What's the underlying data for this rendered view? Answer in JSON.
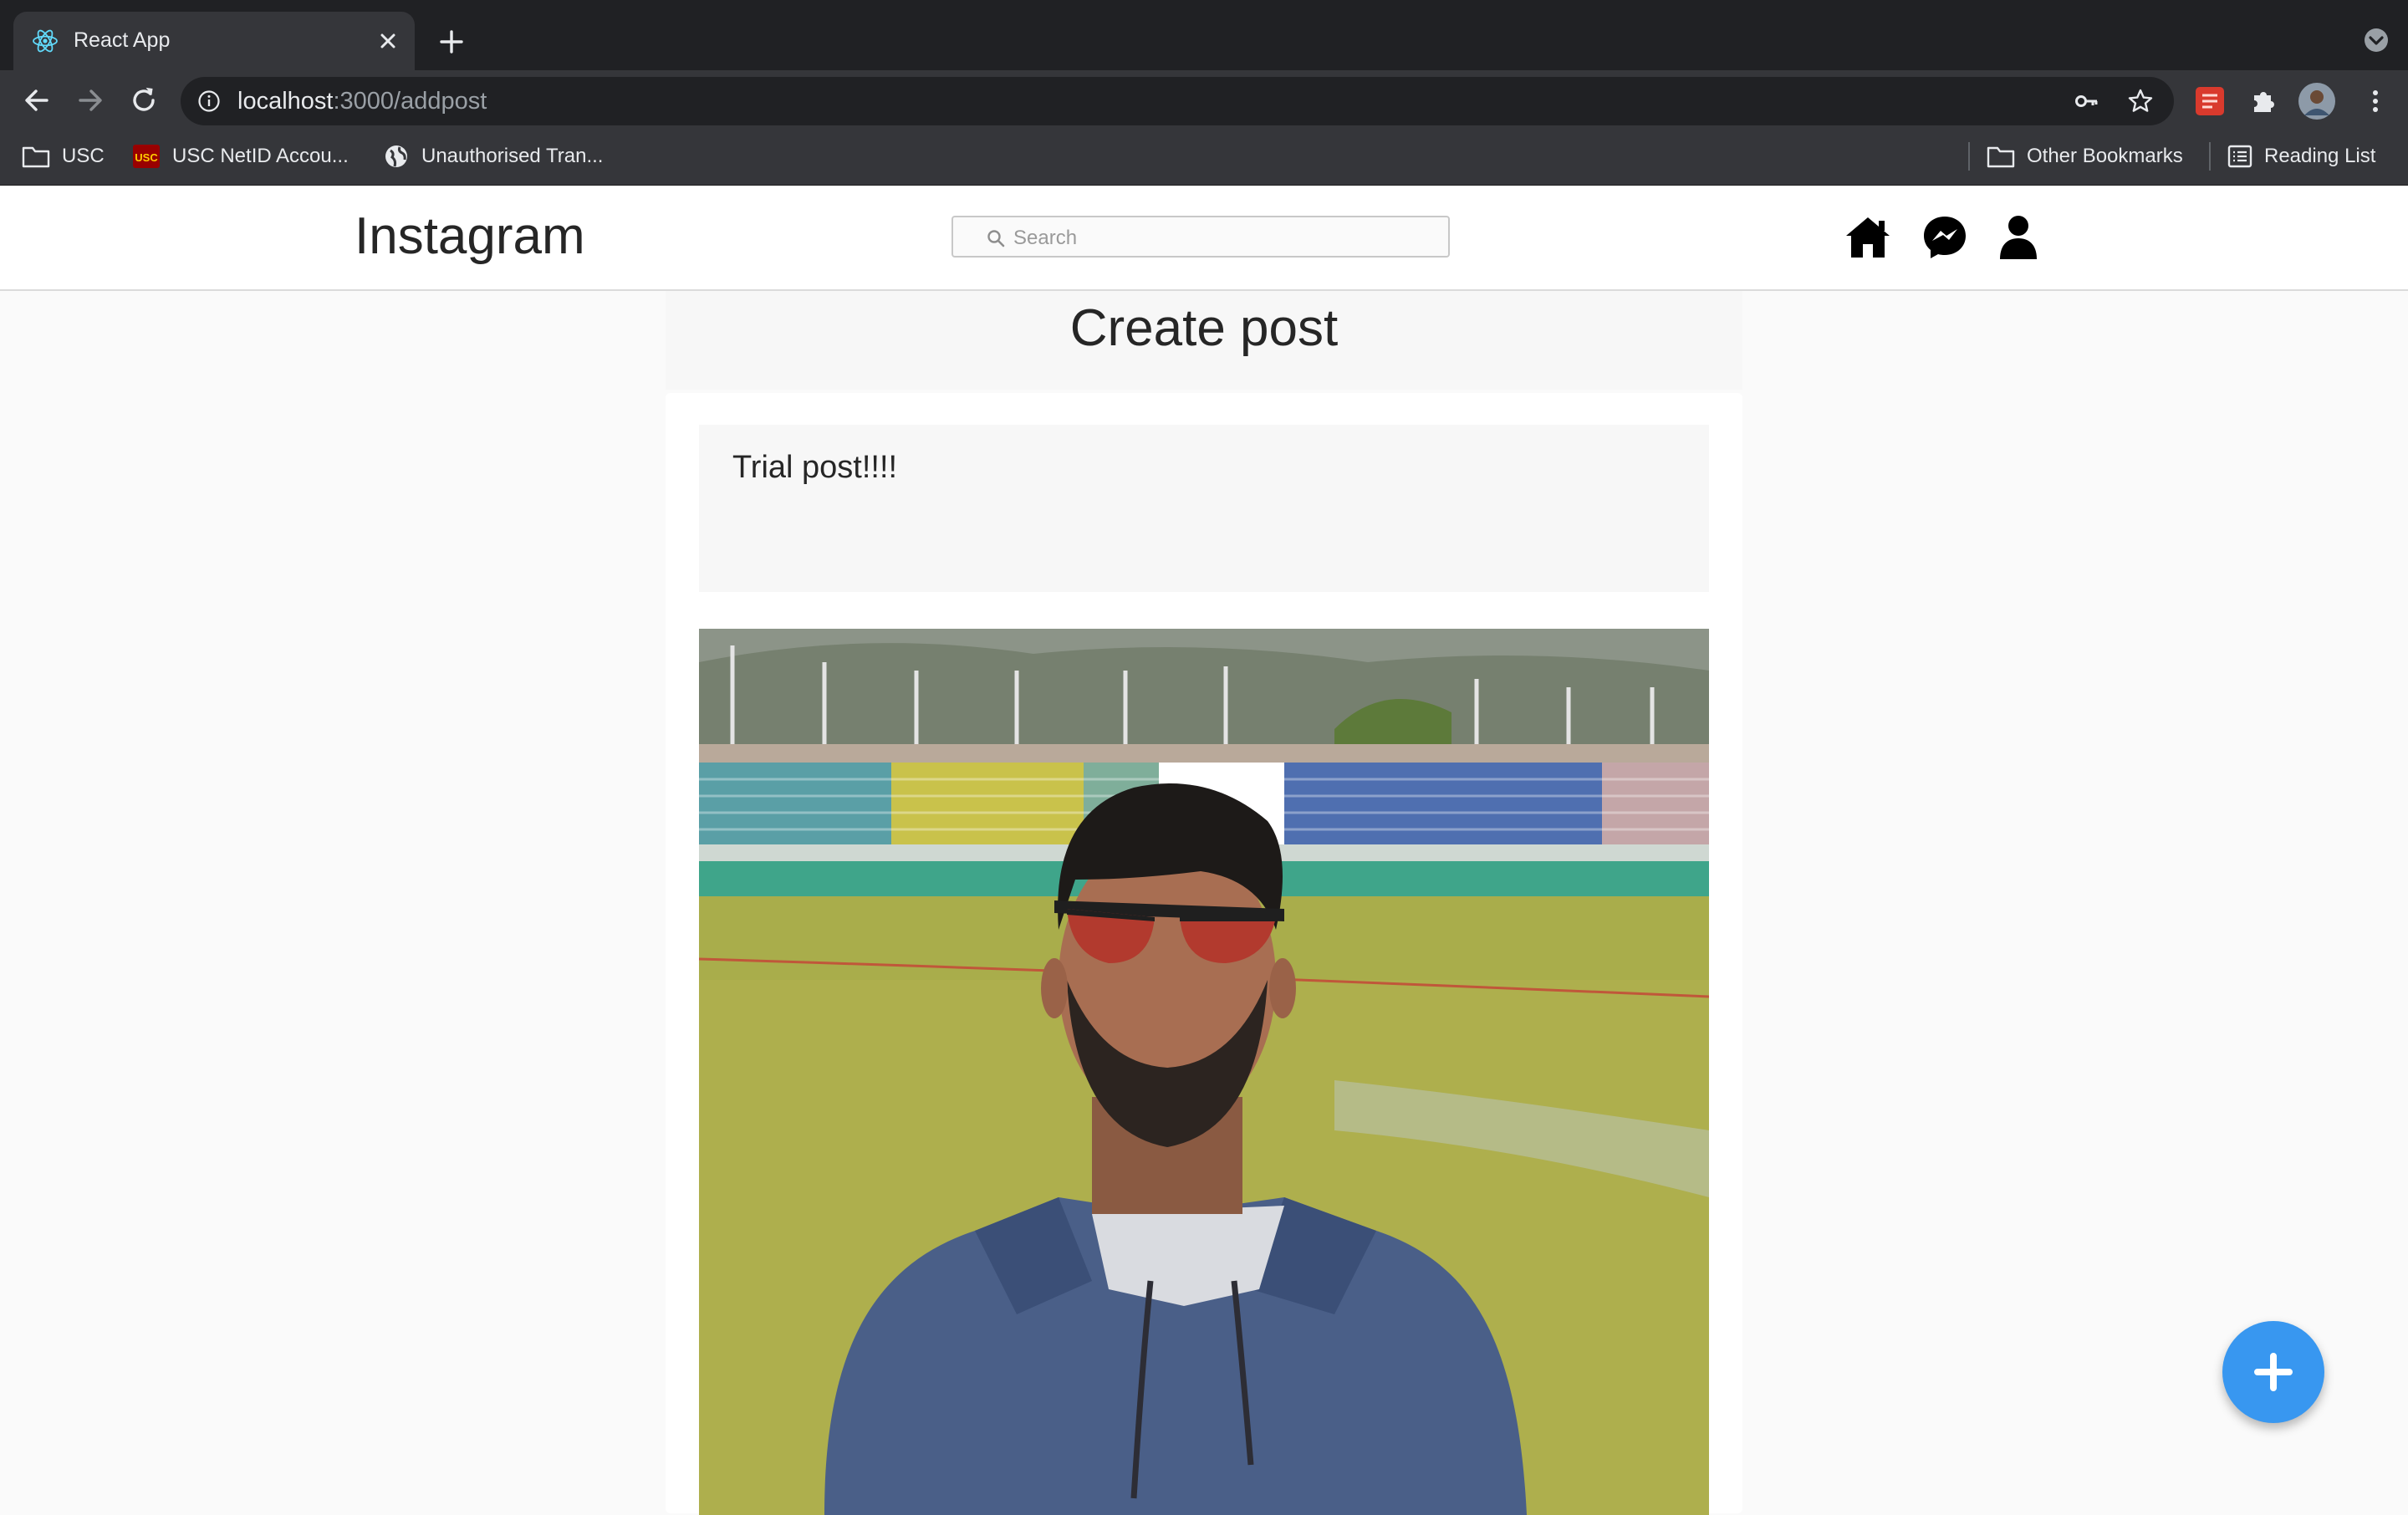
{
  "browser": {
    "tab_title": "React App",
    "url_host": "localhost",
    "url_path": ":3000/addpost",
    "bookmarks": [
      {
        "label": "USC",
        "icon": "folder-icon"
      },
      {
        "label": "USC NetID Accou...",
        "icon": "usc-logo-icon"
      },
      {
        "label": "Unauthorised Tran...",
        "icon": "globe-icon"
      }
    ],
    "right_bookmarks": [
      {
        "label": "Other Bookmarks",
        "icon": "folder-icon"
      },
      {
        "label": "Reading List",
        "icon": "reading-list-icon"
      }
    ]
  },
  "header": {
    "logo": "Instagram",
    "search_placeholder": "Search",
    "icons": [
      "home-icon",
      "messenger-icon",
      "profile-icon"
    ]
  },
  "page": {
    "title": "Create post",
    "caption_value": "Trial post!!!!",
    "fab_icon": "plus-icon"
  },
  "colors": {
    "accent": "#3897f0",
    "chrome_dark": "#202124",
    "chrome_toolbar": "#35363a",
    "page_bg": "#fafafa"
  }
}
